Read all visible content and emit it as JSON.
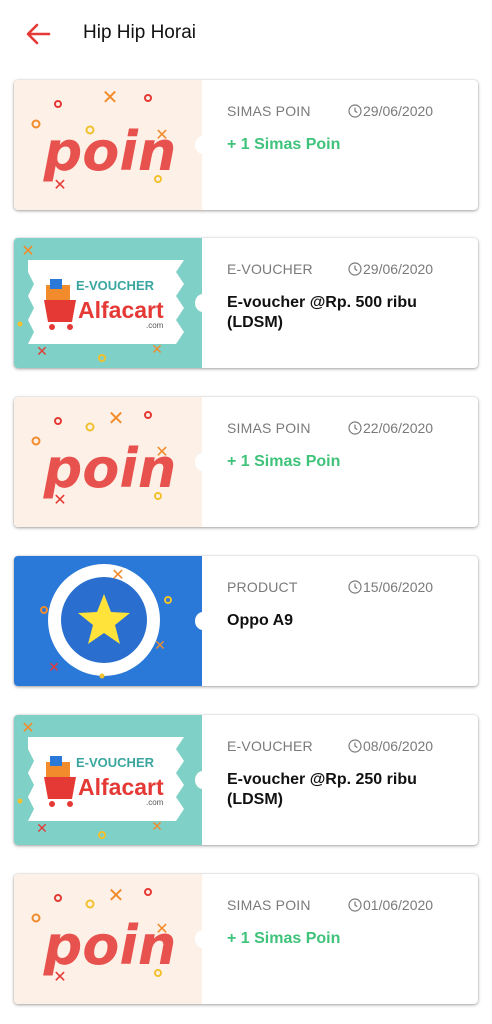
{
  "header": {
    "title": "Hip Hip Horai"
  },
  "cards": [
    {
      "category": "SIMAS POIN",
      "date": "29/06/2020",
      "description": "+ 1 Simas Poin",
      "thumb": "poin"
    },
    {
      "category": "E-VOUCHER",
      "date": "29/06/2020",
      "description": "E-voucher @Rp. 500 ribu (LDSM)",
      "thumb": "alfacart"
    },
    {
      "category": "SIMAS POIN",
      "date": "22/06/2020",
      "description": "+ 1 Simas Poin",
      "thumb": "poin"
    },
    {
      "category": "PRODUCT",
      "date": "15/06/2020",
      "description": "Oppo A9",
      "thumb": "product"
    },
    {
      "category": "E-VOUCHER",
      "date": "08/06/2020",
      "description": "E-voucher @Rp. 250 ribu (LDSM)",
      "thumb": "alfacart"
    },
    {
      "category": "SIMAS POIN",
      "date": "01/06/2020",
      "description": "+ 1 Simas Poin",
      "thumb": "poin"
    }
  ],
  "thumb_text": {
    "poin": "poin",
    "evoucher": "E-VOUCHER",
    "alfacart": "Alfacart",
    "dotcom": ".com"
  },
  "colors": {
    "accent": "#e53935",
    "points_green": "#3fc27a",
    "poin_bg": "#fdf0e6",
    "voucher_bg": "#7fd0c6",
    "product_bg": "#2a79d8"
  }
}
